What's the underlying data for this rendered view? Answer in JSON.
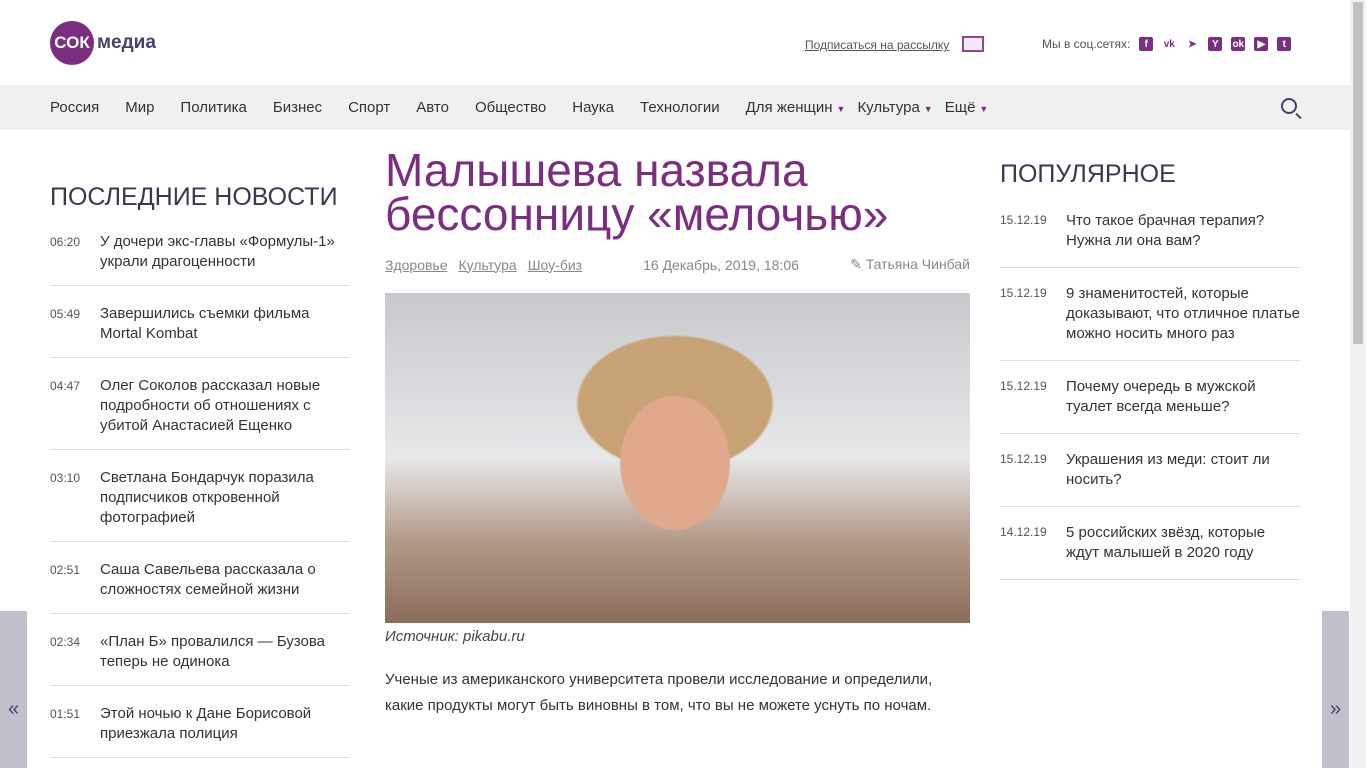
{
  "header": {
    "logo_circle": "СОК",
    "logo_word": "медиа",
    "subscribe": "Подписаться на рассылку",
    "social_label": "Мы в соц.сетях:",
    "social": [
      "f",
      "vk",
      "➤",
      "Y",
      "ok",
      "▶",
      "t"
    ]
  },
  "nav": {
    "items": [
      "Россия",
      "Мир",
      "Политика",
      "Бизнес",
      "Спорт",
      "Авто",
      "Общество",
      "Наука",
      "Технологии"
    ],
    "dropdowns": [
      "Для женщин",
      "Культура",
      "Ещё"
    ]
  },
  "latest": {
    "heading": "Последние новости",
    "items": [
      {
        "time": "06:20",
        "title": "У дочери экс-главы «Формулы-1» украли драгоценности"
      },
      {
        "time": "05:49",
        "title": "Завершились съемки фильма Mortal Kombat"
      },
      {
        "time": "04:47",
        "title": "Олег Соколов рассказал новые подробности об отношениях с убитой Анастасией Ещенко"
      },
      {
        "time": "03:10",
        "title": "Светлана Бондарчук поразила подписчиков откровенной фотографией"
      },
      {
        "time": "02:51",
        "title": "Саша Савельева рассказала о сложностях семейной жизни"
      },
      {
        "time": "02:34",
        "title": "«План Б» провалился — Бузова теперь не одинока"
      },
      {
        "time": "01:51",
        "title": "Этой ночью к Дане Борисовой приезжала полиция"
      }
    ]
  },
  "article": {
    "title": "Малышева назвала бессонницу «мелочью»",
    "tags": [
      "Здоровье",
      "Культура",
      "Шоу-биз"
    ],
    "date": "16 Декабрь, 2019, 18:06",
    "author": "Татьяна Чинбай",
    "caption": "Источник: pikabu.ru",
    "body": "Ученые из американского университета провели исследование и определили, какие продукты могут быть виновны в том, что вы не можете уснуть по ночам."
  },
  "popular": {
    "heading": "Популярное",
    "items": [
      {
        "date": "15.12.19",
        "title": "Что такое брачная терапия? Нужна ли она вам?"
      },
      {
        "date": "15.12.19",
        "title": "9 знаменитостей, которые доказывают, что отличное платье можно носить много раз"
      },
      {
        "date": "15.12.19",
        "title": "Почему очередь в мужской туалет всегда меньше?"
      },
      {
        "date": "15.12.19",
        "title": "Украшения из меди: стоит ли носить?"
      },
      {
        "date": "14.12.19",
        "title": "5 российских звёзд, которые ждут малышей в 2020 году"
      }
    ]
  }
}
